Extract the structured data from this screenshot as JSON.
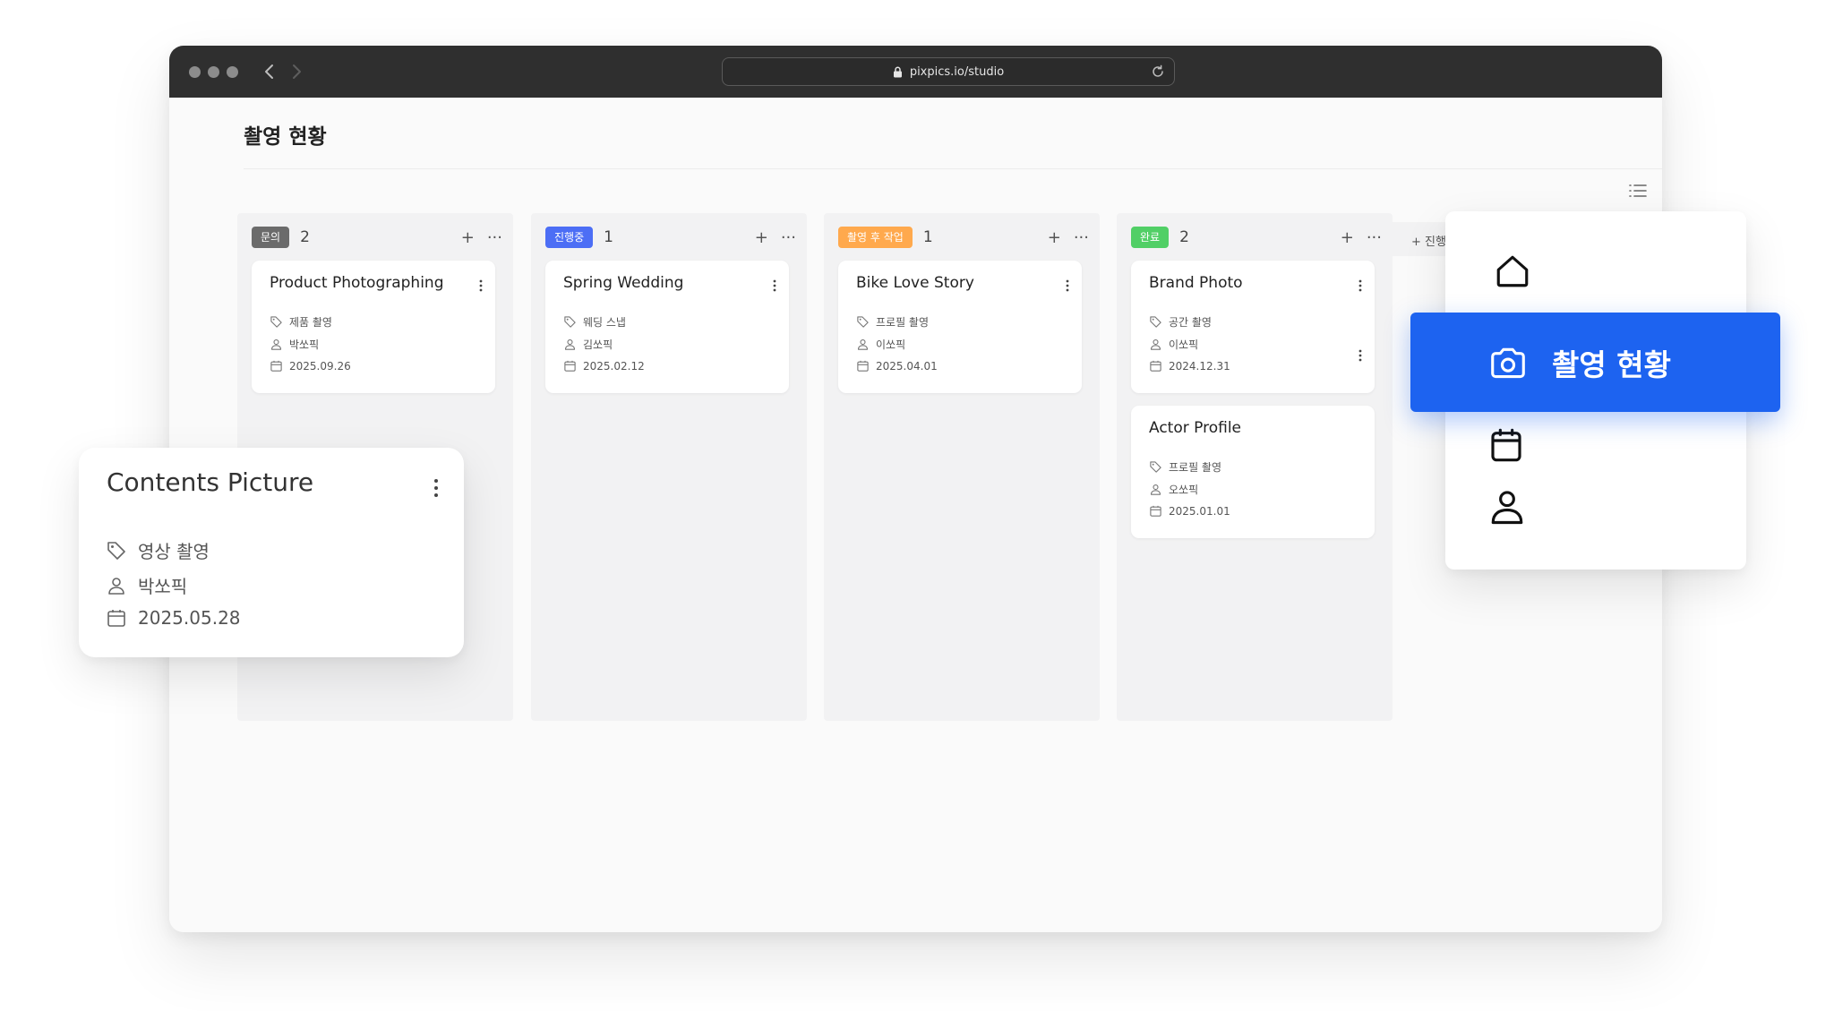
{
  "browser": {
    "url": "pixpics.io/studio"
  },
  "page": {
    "title": "촬영 현황"
  },
  "columns": [
    {
      "status": "문의",
      "badge_color": "#6b6b6b",
      "count": "2",
      "cards": [
        {
          "title": "Product Photographing",
          "category": "제품 촬영",
          "person": "박쏘픽",
          "date": "2025.09.26"
        }
      ]
    },
    {
      "status": "진행중",
      "badge_color": "#4c6ef5",
      "count": "1",
      "cards": [
        {
          "title": "Spring Wedding",
          "category": "웨딩 스냅",
          "person": "김쏘픽",
          "date": "2025.02.12"
        }
      ]
    },
    {
      "status": "촬영 후 작업",
      "badge_color": "#ffa94d",
      "count": "1",
      "cards": [
        {
          "title": "Bike Love Story",
          "category": "프로필 촬영",
          "person": "이쏘픽",
          "date": "2025.04.01"
        }
      ]
    },
    {
      "status": "완료",
      "badge_color": "#51cf66",
      "count": "2",
      "cards": [
        {
          "title": "Brand Photo",
          "category": "공간 촬영",
          "person": "이쏘픽",
          "date": "2024.12.31"
        },
        {
          "title": "Actor Profile",
          "category": "프로필 촬영",
          "person": "오쏘픽",
          "date": "2025.01.01"
        }
      ]
    }
  ],
  "add_column": {
    "label": "+ 진행"
  },
  "floating_card": {
    "title": "Contents Picture",
    "category": "영상 촬영",
    "person": "박쏘픽",
    "date": "2025.05.28"
  },
  "side_menu": {
    "items": [
      {
        "icon": "home-icon"
      },
      {
        "icon": "camera-icon",
        "label": "촬영 현황",
        "active": true
      },
      {
        "icon": "calendar-icon"
      },
      {
        "icon": "user-icon"
      }
    ],
    "active_color": "#1d63f0"
  }
}
